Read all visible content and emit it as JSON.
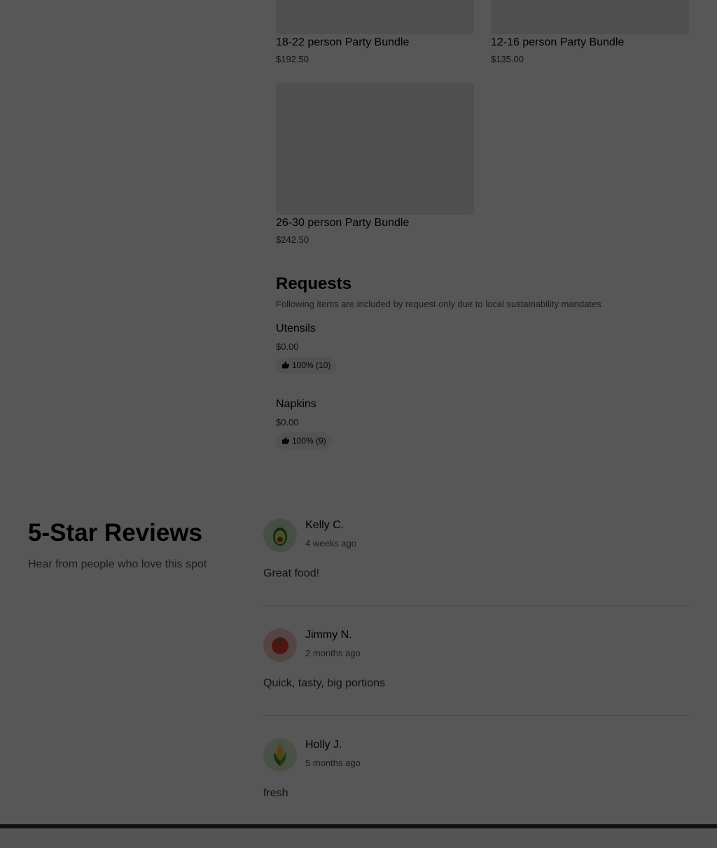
{
  "bundles": [
    {
      "name": "18-22 person Party Bundle",
      "price": "$192.50"
    },
    {
      "name": "12-16 person Party Bundle",
      "price": "$135.00"
    },
    {
      "name": "26-30 person Party Bundle",
      "price": "$242.50"
    }
  ],
  "requests": {
    "title": "Requests",
    "subtitle": "Following items are included by request only due to local sustainability mandates",
    "items": [
      {
        "name": "Utensils",
        "price": "$0.00",
        "rating": "100% (10)"
      },
      {
        "name": "Napkins",
        "price": "$0.00",
        "rating": "100% (9)"
      }
    ]
  },
  "reviews": {
    "title": "5-Star Reviews",
    "subtitle": "Hear from people who love this spot",
    "items": [
      {
        "name": "Kelly C.",
        "time": "4 weeks ago",
        "text": "Great food!",
        "avatar_icon": "avocado-icon"
      },
      {
        "name": "Jimmy N.",
        "time": "2 months ago",
        "text": "Quick, tasty, big portions",
        "avatar_icon": "tomato-icon"
      },
      {
        "name": "Holly J.",
        "time": "5 months ago",
        "text": "fresh",
        "avatar_icon": "corn-icon"
      }
    ]
  },
  "colors": {
    "overlay": "#000000",
    "avocado_bg": "#cfe6c0",
    "tomato_bg": "#f7c9c9",
    "corn_bg": "#d7ecd0"
  }
}
